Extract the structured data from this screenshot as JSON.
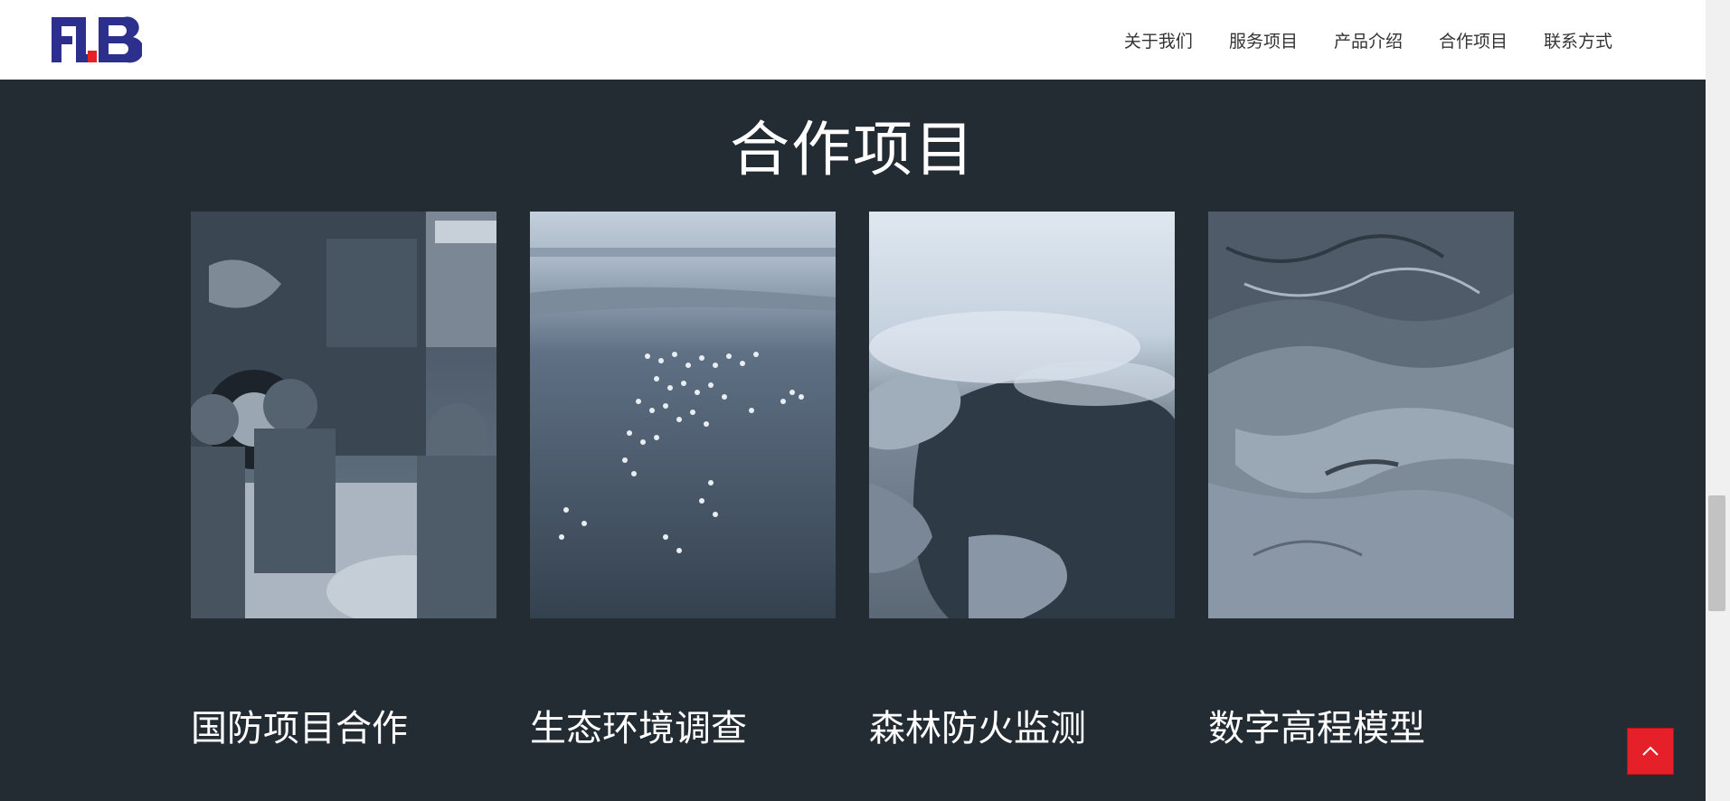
{
  "header": {
    "logo_text": "FLB",
    "nav": [
      "关于我们",
      "服务项目",
      "产品介绍",
      "合作项目",
      "联系方式"
    ]
  },
  "section": {
    "title": "合作项目",
    "cards": [
      {
        "caption": "国防项目合作"
      },
      {
        "caption": "生态环境调查"
      },
      {
        "caption": "森林防火监测"
      },
      {
        "caption": "数字高程模型"
      }
    ]
  },
  "colors": {
    "brand_blue": "#2d2f8c",
    "brand_red": "#e62028",
    "background": "#232b33"
  },
  "icons": {
    "back_to_top": "chevron-up-icon"
  }
}
